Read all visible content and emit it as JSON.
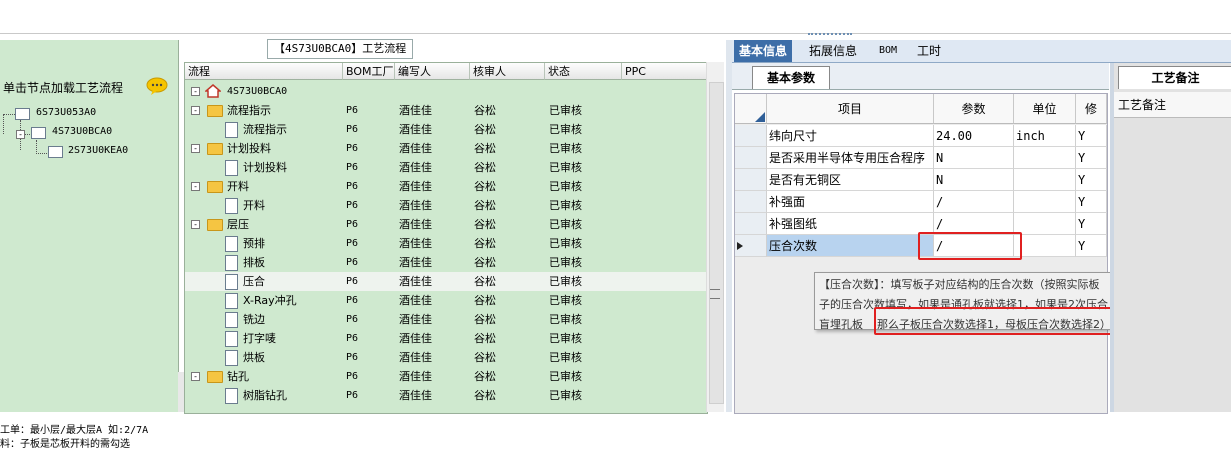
{
  "left_panel": {
    "title": "单击节点加载工艺流程",
    "tree": [
      {
        "label": "6S73U053A0",
        "level": 0
      },
      {
        "label": "4S73U0BCA0",
        "level": 1
      },
      {
        "label": "2S73U0KEA0",
        "level": 2
      }
    ],
    "notes": [
      "工单：最小层/最大层A 如:2/7A",
      "料：子板是芯板开料的需勾选"
    ]
  },
  "flow_group_title": "【4S73U0BCA0】工艺流程",
  "flow_grid": {
    "columns": [
      "流程",
      "BOM工厂",
      "编写人",
      "核审人",
      "状态",
      "PPC"
    ],
    "rows": [
      {
        "name": "4S73U0BCA0",
        "type": "root",
        "factory": "",
        "author": "",
        "reviewer": "",
        "status": "",
        "ppc": ""
      },
      {
        "name": "流程指示",
        "type": "folder",
        "factory": "P6",
        "author": "酒佳佳",
        "reviewer": "谷松",
        "status": "已审核",
        "ppc": ""
      },
      {
        "name": "流程指示",
        "type": "leaf",
        "factory": "P6",
        "author": "酒佳佳",
        "reviewer": "谷松",
        "status": "已审核",
        "ppc": ""
      },
      {
        "name": "计划投料",
        "type": "folder",
        "factory": "P6",
        "author": "酒佳佳",
        "reviewer": "谷松",
        "status": "已审核",
        "ppc": ""
      },
      {
        "name": "计划投料",
        "type": "leaf",
        "factory": "P6",
        "author": "酒佳佳",
        "reviewer": "谷松",
        "status": "已审核",
        "ppc": ""
      },
      {
        "name": "开料",
        "type": "folder",
        "factory": "P6",
        "author": "酒佳佳",
        "reviewer": "谷松",
        "status": "已审核",
        "ppc": ""
      },
      {
        "name": "开料",
        "type": "leaf",
        "factory": "P6",
        "author": "酒佳佳",
        "reviewer": "谷松",
        "status": "已审核",
        "ppc": ""
      },
      {
        "name": "层压",
        "type": "folder",
        "factory": "P6",
        "author": "酒佳佳",
        "reviewer": "谷松",
        "status": "已审核",
        "ppc": ""
      },
      {
        "name": "预排",
        "type": "leaf",
        "factory": "P6",
        "author": "酒佳佳",
        "reviewer": "谷松",
        "status": "已审核",
        "ppc": ""
      },
      {
        "name": "排板",
        "type": "leaf",
        "factory": "P6",
        "author": "酒佳佳",
        "reviewer": "谷松",
        "status": "已审核",
        "ppc": ""
      },
      {
        "name": "压合",
        "type": "leaf",
        "factory": "P6",
        "author": "酒佳佳",
        "reviewer": "谷松",
        "status": "已审核",
        "ppc": "",
        "selected": true
      },
      {
        "name": "X-Ray冲孔",
        "type": "leaf",
        "factory": "P6",
        "author": "酒佳佳",
        "reviewer": "谷松",
        "status": "已审核",
        "ppc": ""
      },
      {
        "name": "铣边",
        "type": "leaf",
        "factory": "P6",
        "author": "酒佳佳",
        "reviewer": "谷松",
        "status": "已审核",
        "ppc": ""
      },
      {
        "name": "打字唛",
        "type": "leaf",
        "factory": "P6",
        "author": "酒佳佳",
        "reviewer": "谷松",
        "status": "已审核",
        "ppc": ""
      },
      {
        "name": "烘板",
        "type": "leaf",
        "factory": "P6",
        "author": "酒佳佳",
        "reviewer": "谷松",
        "status": "已审核",
        "ppc": ""
      },
      {
        "name": "钻孔",
        "type": "folder",
        "factory": "P6",
        "author": "酒佳佳",
        "reviewer": "谷松",
        "status": "已审核",
        "ppc": ""
      },
      {
        "name": "树脂钻孔",
        "type": "leaf",
        "factory": "P6",
        "author": "酒佳佳",
        "reviewer": "谷松",
        "status": "已审核",
        "ppc": ""
      }
    ]
  },
  "tabs": [
    "基本信息",
    "拓展信息",
    "BOM",
    "工时"
  ],
  "active_tab": 0,
  "subtab": "基本参数",
  "param_grid": {
    "columns": [
      "项目",
      "参数",
      "单位",
      "修"
    ],
    "rows": [
      {
        "item": "纬向尺寸",
        "value": "24.00",
        "unit": "inch",
        "flag": "Y"
      },
      {
        "item": "是否采用半导体专用压合程序",
        "value": "N",
        "unit": "",
        "flag": "Y"
      },
      {
        "item": "是否有无铜区",
        "value": "N",
        "unit": "",
        "flag": "Y"
      },
      {
        "item": "补强面",
        "value": "/",
        "unit": "",
        "flag": "Y"
      },
      {
        "item": "补强图纸",
        "value": "/",
        "unit": "",
        "flag": "Y"
      },
      {
        "item": "压合次数",
        "value": "/",
        "unit": "",
        "flag": "Y",
        "selected": true
      }
    ]
  },
  "tooltip": {
    "line1": "【压合次数】：填写板子对应结构的压合次数（按照实际板",
    "line2": "子的压合次数填写，如果是通孔板就选择1，如果是2次压合",
    "line3a": "盲埋孔板",
    "line3b": "那么子板压合次数选择1，母板压合次数选择2）"
  },
  "remark": {
    "tab": "工艺备注",
    "header": "工艺备注"
  },
  "colors": {
    "tree_bg": "#cfe9cf",
    "tab_active": "#3d6ea8",
    "highlight_box": "#e02020",
    "selected_cell": "#b8d3ef"
  }
}
